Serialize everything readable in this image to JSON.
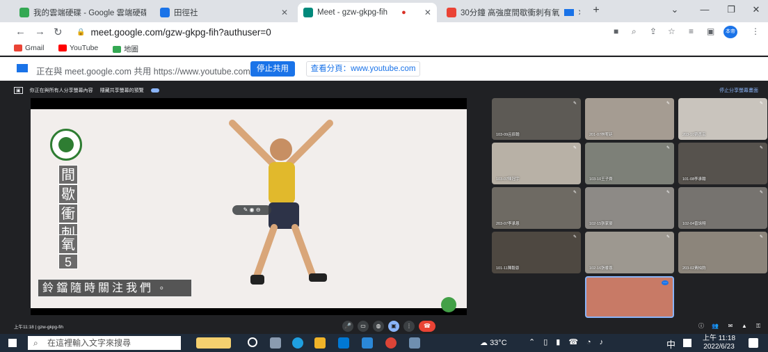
{
  "browser": {
    "tabs": [
      {
        "label": "我的雲端硬碟 - Google 雲端硬碟",
        "color": "#34a853"
      },
      {
        "label": "田徑社",
        "color": "#1a73e8"
      },
      {
        "label": "Meet - gzw-gkpg-fih",
        "color": "#00897b"
      },
      {
        "label": "30分鐘 高強度間歇衝刺有氧",
        "color": "#ea4335"
      }
    ],
    "address": "meet.google.com/gzw-gkpg-fih?authuser=0",
    "profile": "本帝",
    "new_tab": "+"
  },
  "bookmarks": [
    {
      "label": "Gmail",
      "color": "#ea4335"
    },
    {
      "label": "YouTube",
      "color": "#ff0000"
    },
    {
      "label": "地圖",
      "color": "#34a853"
    }
  ],
  "share_bar": {
    "message": "正在與 meet.google.com 共用 https://www.youtube.com",
    "stop_button": "停止共用",
    "view_button": "查看分頁：www.youtube.com"
  },
  "meet": {
    "top_left": "你正在與所有人分享螢幕內容",
    "top_left2": "隱藏共享螢幕的預覽",
    "top_right": "停止分享螢幕畫面",
    "slide_title_chars": [
      "間",
      "歇",
      "衝",
      "刺",
      "有",
      "氧",
      "5"
    ],
    "subtitle": "鈴鐺隨時關注我們 ◦",
    "time_info": "上午11:18",
    "meeting_code": "gzw-gkpg-fih",
    "participants": [
      {
        "name": "103-09呂辰翰",
        "color": "#5d5a55"
      },
      {
        "name": "201-07林宥廷",
        "color": "#a59c92"
      },
      {
        "name": "203-10劉彥宏",
        "color": "#c9c4bd"
      },
      {
        "name": "103-07陳冠宇",
        "color": "#b8b1a6"
      },
      {
        "name": "103-10王子齊",
        "color": "#7d8078"
      },
      {
        "name": "101-08李承翰",
        "color": "#56524d"
      },
      {
        "name": "203-07李承恩",
        "color": "#6e6a63"
      },
      {
        "name": "102-15張家豪",
        "color": "#8d8a86"
      },
      {
        "name": "102-04曾詠翔",
        "color": "#76736f"
      },
      {
        "name": "101-11陳毅恩",
        "color": "#4e4841"
      },
      {
        "name": "102-16張睿恩",
        "color": "#9d9890"
      },
      {
        "name": "203-02黃柏鈞",
        "color": "#8c857b"
      },
      {
        "name": "",
        "color": "#c87a66"
      }
    ]
  },
  "taskbar": {
    "search_placeholder": "在這裡輸入文字來搜尋",
    "weather": "33°C",
    "ime": "中",
    "time": "上午 11:18",
    "date": "2022/6/23"
  }
}
